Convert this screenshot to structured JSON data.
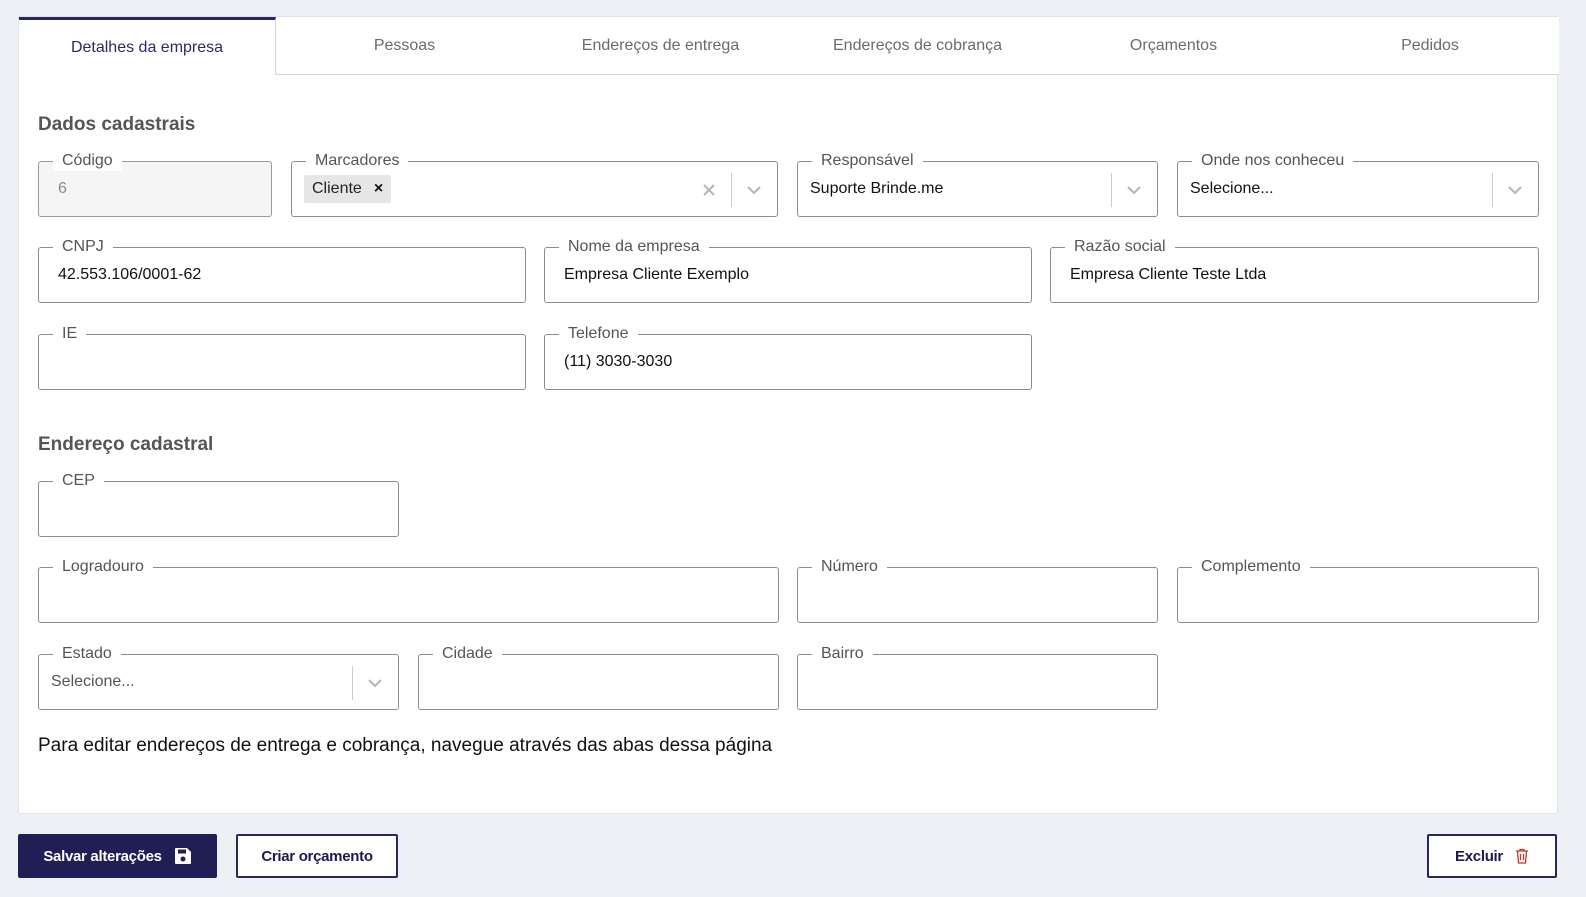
{
  "tabs": [
    {
      "label": "Detalhes da empresa",
      "active": true
    },
    {
      "label": "Pessoas"
    },
    {
      "label": "Endereços de entrega"
    },
    {
      "label": "Endereços de cobrança"
    },
    {
      "label": "Orçamentos"
    },
    {
      "label": "Pedidos"
    }
  ],
  "sections": {
    "dados": "Dados cadastrais",
    "endereco": "Endereço cadastral"
  },
  "fields": {
    "codigo": {
      "label": "Código",
      "value": "6"
    },
    "marcadores": {
      "label": "Marcadores",
      "chip": "Cliente"
    },
    "responsavel": {
      "label": "Responsável",
      "value": "Suporte Brinde.me"
    },
    "onde": {
      "label": "Onde nos conheceu",
      "placeholder": "Selecione..."
    },
    "cnpj": {
      "label": "CNPJ",
      "value": "42.553.106/0001-62"
    },
    "nome": {
      "label": "Nome da empresa",
      "value": "Empresa Cliente Exemplo"
    },
    "razao": {
      "label": "Razão social",
      "value": "Empresa Cliente Teste Ltda"
    },
    "ie": {
      "label": "IE",
      "value": ""
    },
    "telefone": {
      "label": "Telefone",
      "value": "(11) 3030-3030"
    },
    "cep": {
      "label": "CEP",
      "value": ""
    },
    "logradouro": {
      "label": "Logradouro",
      "value": ""
    },
    "numero": {
      "label": "Número",
      "value": ""
    },
    "complemento": {
      "label": "Complemento",
      "value": ""
    },
    "estado": {
      "label": "Estado",
      "placeholder": "Selecione..."
    },
    "cidade": {
      "label": "Cidade",
      "value": ""
    },
    "bairro": {
      "label": "Bairro",
      "value": ""
    }
  },
  "note": "Para editar endereços de entrega e cobrança, navegue através das abas dessa página",
  "buttons": {
    "save": "Salvar alterações",
    "create": "Criar orçamento",
    "delete": "Excluir"
  },
  "colors": {
    "accent": "#211d55",
    "delete_icon": "#c0392b"
  }
}
